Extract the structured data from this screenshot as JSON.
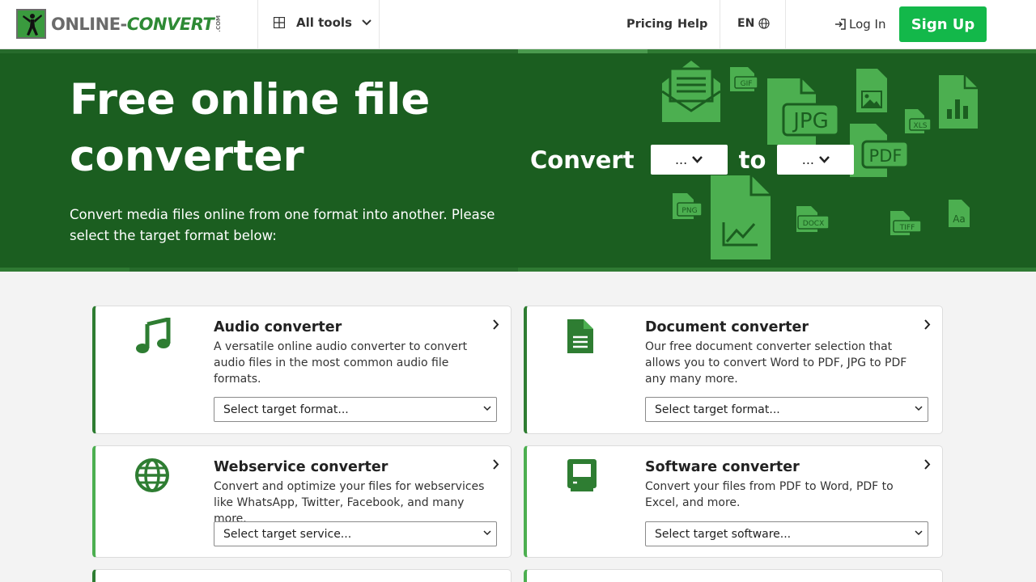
{
  "header": {
    "logo_text_a": "ONLINE-",
    "logo_text_b": "CONVERT",
    "logo_com": ".COM",
    "all_tools_label": "All tools",
    "nav": {
      "pricing": "Pricing",
      "help": "Help"
    },
    "language": "EN",
    "login_label": "Log In",
    "signup_label": "Sign Up"
  },
  "hero": {
    "title": "Free online file converter",
    "subtitle": "Convert media files online from one format into another. Please select the target format below:",
    "convert_label": "Convert",
    "to_label": "to",
    "from_select_value": "...",
    "to_select_value": "...",
    "file_icon_labels": [
      "GIF",
      "JPG",
      "XLS",
      "PDF",
      "PNG",
      "DOCX",
      "TIFF",
      "Aa"
    ],
    "colors": {
      "background": "#1b5e20",
      "icon_green": "#4caf50"
    }
  },
  "cards": [
    {
      "title": "Audio converter",
      "description": "A versatile online audio converter to convert audio files in the most common audio file formats.",
      "select_placeholder": "Select target format...",
      "icon": "music-note-icon"
    },
    {
      "title": "Document converter",
      "description": "Our free document converter selection that allows you to convert Word to PDF, JPG to PDF any many more.",
      "select_placeholder": "Select target format...",
      "icon": "document-icon"
    },
    {
      "title": "Webservice converter",
      "description": "Convert and optimize your files for webservices like WhatsApp, Twitter, Facebook, and many more.",
      "select_placeholder": "Select target service...",
      "icon": "globe-icon"
    },
    {
      "title": "Software converter",
      "description": "Convert your files from PDF to Word, PDF to Excel, and more.",
      "select_placeholder": "Select target software...",
      "icon": "computer-icon"
    }
  ],
  "colors": {
    "brand_green": "#2e7d32",
    "signup_green": "#13b84a"
  }
}
